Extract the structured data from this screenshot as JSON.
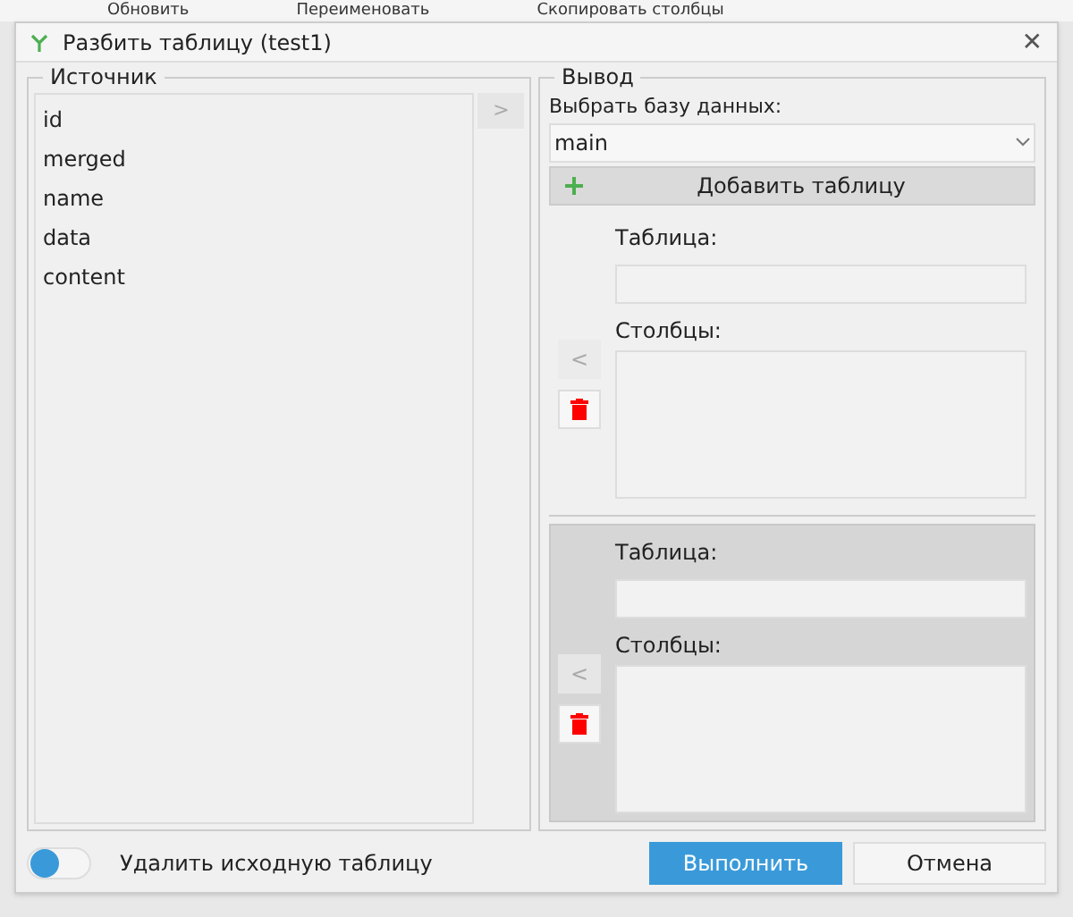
{
  "background_toolbar": [
    "Обновить",
    "Переименовать",
    "Скопировать столбцы"
  ],
  "window": {
    "title": "Разбить таблицу (test1)",
    "close": "✕"
  },
  "source": {
    "title": "Источник",
    "items": [
      "id",
      "merged",
      "name",
      "data",
      "content"
    ],
    "move_button": ">"
  },
  "output": {
    "title": "Вывод",
    "db_label": "Выбрать базу данных:",
    "db_value": "main",
    "add_button": "Добавить таблицу",
    "tables": [
      {
        "selected": false,
        "table_label": "Таблица:",
        "columns_label": "Столбцы:",
        "back_button": "<"
      },
      {
        "selected": true,
        "table_label": "Таблица:",
        "columns_label": "Столбцы:",
        "back_button": "<"
      }
    ]
  },
  "delete_source": {
    "label": "Удалить исходную таблицу",
    "on": false
  },
  "buttons": [
    {
      "label": "Выполнить",
      "kind": "primary"
    },
    {
      "label": "Отмена",
      "kind": "secondary"
    }
  ]
}
